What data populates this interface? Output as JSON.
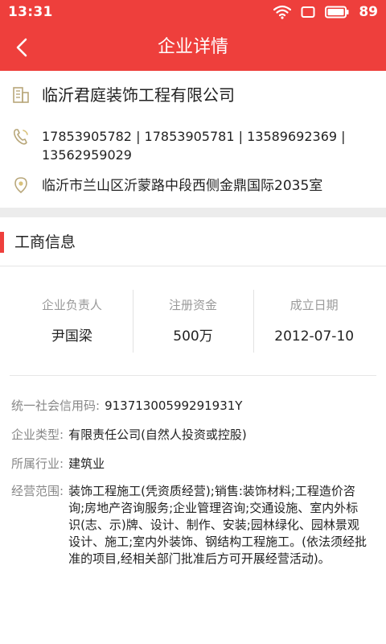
{
  "status_bar": {
    "time": "13:31",
    "battery": "89"
  },
  "app_bar": {
    "title": "企业详情"
  },
  "company": {
    "name": "临沂君庭装饰工程有限公司",
    "phones": "17853905782 | 17853905781 | 13589692369 | 13562959029",
    "address": "临沂市兰山区沂蒙路中段西侧金鼎国际2035室"
  },
  "section": {
    "title": "工商信息"
  },
  "stats": [
    {
      "label": "企业负责人",
      "value": "尹国梁"
    },
    {
      "label": "注册资金",
      "value": "500万"
    },
    {
      "label": "成立日期",
      "value": "2012-07-10"
    }
  ],
  "details": {
    "credit_code": {
      "label": "统一社会信用码:",
      "value": "91371300599291931Y"
    },
    "type": {
      "label": "企业类型:",
      "value": "有限责任公司(自然人投资或控股)"
    },
    "industry": {
      "label": "所属行业:",
      "value": "建筑业"
    },
    "scope": {
      "label": "经营范围:",
      "value": "装饰工程施工(凭资质经营);销售:装饰材料;工程造价咨询;房地产咨询服务;企业管理咨询;交通设施、室内外标识(志、示)牌、设计、制作、安装;园林绿化、园林景观设计、施工;室内外装饰、钢结构工程施工。(依法须经批准的项目,经相关部门批准后方可开展经营活动)。"
    }
  },
  "colors": {
    "accent": "#ee3f3c",
    "muted": "#9a9a9a",
    "band": "#ececec"
  }
}
